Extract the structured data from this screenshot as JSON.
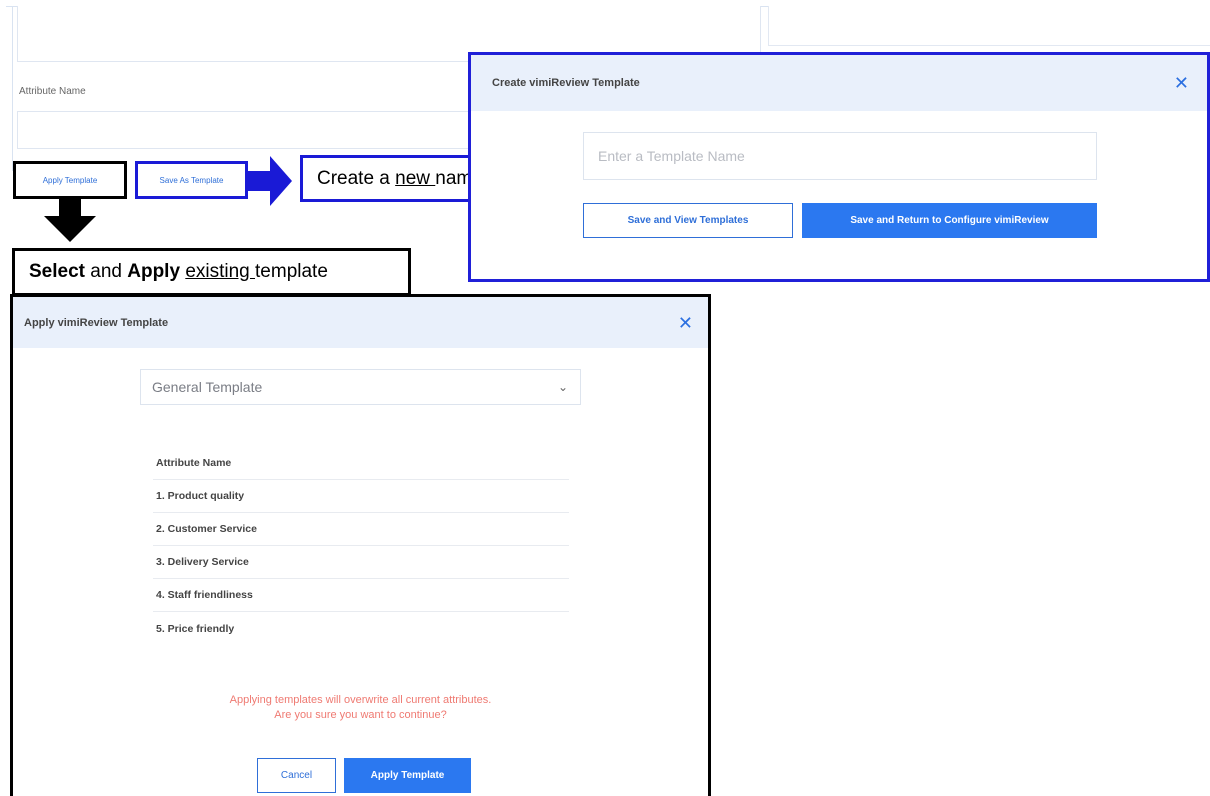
{
  "background": {
    "attribute_label": "Attribute Name",
    "apply_template_button": "Apply Template",
    "save_as_template_button": "Save As Template"
  },
  "callouts": {
    "create": {
      "pre": "Create a ",
      "underlined": "new ",
      "post": "name and save"
    },
    "select": {
      "bold1": "Select",
      "mid": " and ",
      "bold2": "Apply",
      "space": " ",
      "underlined": "existing ",
      "post": "template"
    }
  },
  "create_modal": {
    "title": "Create vimiReview Template",
    "close_glyph": "✕",
    "name_placeholder": "Enter a Template Name",
    "save_view_button": "Save and View Templates",
    "save_return_button": "Save and Return to Configure vimiReview"
  },
  "apply_modal": {
    "title": "Apply vimiReview Template",
    "close_glyph": "✕",
    "selected_template": "General Template",
    "chevron_glyph": "⌄",
    "table_header": "Attribute Name",
    "attributes": [
      "1. Product quality",
      "2. Customer Service",
      "3. Delivery Service",
      "4. Staff friendliness",
      "5. Price friendly"
    ],
    "warning_line1": "Applying templates will overwrite all current attributes.",
    "warning_line2": "Are you sure you want to continue?",
    "cancel_button": "Cancel",
    "apply_button": "Apply Template"
  },
  "colors": {
    "accent": "#2b78f0",
    "header_bg": "#e9f0fb",
    "warning": "#ef7a72",
    "callout_blue": "#1a1ad6"
  }
}
